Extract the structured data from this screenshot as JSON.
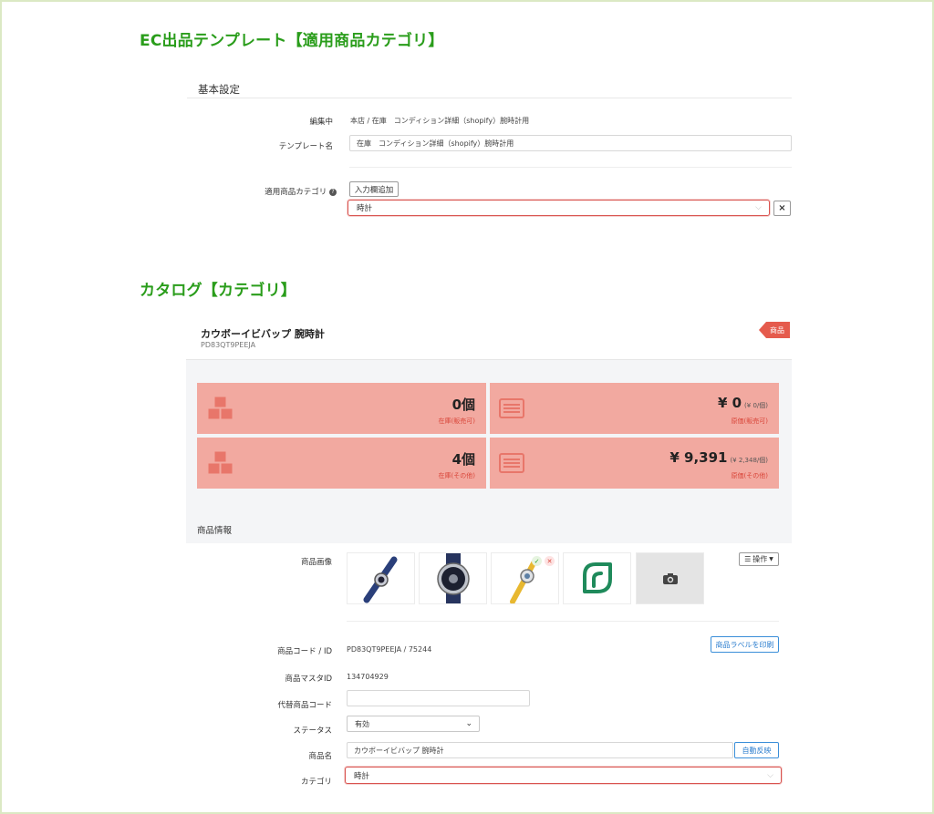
{
  "section1": {
    "title": "EC出品テンプレート【適用商品カテゴリ】",
    "panel_heading": "基本設定",
    "editing_label": "編集中",
    "editing_value": "本店 / 在庫　コンディション詳細（shopify）腕時計用",
    "template_name_label": "テンプレート名",
    "template_name_value": "在庫　コンディション詳細（shopify）腕時計用",
    "category_label": "適用商品カテゴリ",
    "help_icon": "question-circle-icon",
    "add_field_button": "入力欄追加",
    "category_value": "時計",
    "remove_icon": "close-icon"
  },
  "section2": {
    "title": "カタログ【カテゴリ】",
    "product_title": "カウボーイビバップ 腕時計",
    "product_code": "PD83QT9PEEJA",
    "badge": "商品",
    "stats": [
      {
        "value": "0個",
        "sub": "",
        "label": "在庫(販売可)",
        "icon": "boxes-icon"
      },
      {
        "value": "¥ 0",
        "sub": "(¥ 0/個)",
        "label": "原価(販売可)",
        "icon": "list-icon"
      },
      {
        "value": "4個",
        "sub": "",
        "label": "在庫(その他)",
        "icon": "boxes-icon"
      },
      {
        "value": "¥ 9,391",
        "sub": "(¥ 2,348/個)",
        "label": "原価(その他)",
        "icon": "list-icon"
      }
    ],
    "info_heading": "商品情報",
    "image_label": "商品画像",
    "operations_button": "操作",
    "code_label": "商品コード / ID",
    "code_value": "PD83QT9PEEJA / 75244",
    "print_label_button": "商品ラベルを印刷",
    "master_id_label": "商品マスタID",
    "master_id_value": "134704929",
    "alt_code_label": "代替商品コード",
    "alt_code_value": "",
    "status_label": "ステータス",
    "status_value": "有効",
    "name_label": "商品名",
    "name_value": "カウボーイビバップ 腕時計",
    "auto_reflect_button": "自動反映",
    "category_label": "カテゴリ",
    "category_value": "時計"
  },
  "colors": {
    "heading_green": "#2a9d1b",
    "stat_bg": "#f2a9a0",
    "stat_label_red": "#d9463a",
    "highlight_border": "#d9534f",
    "badge_red": "#e55b4d",
    "link_blue": "#2e7fcf"
  }
}
